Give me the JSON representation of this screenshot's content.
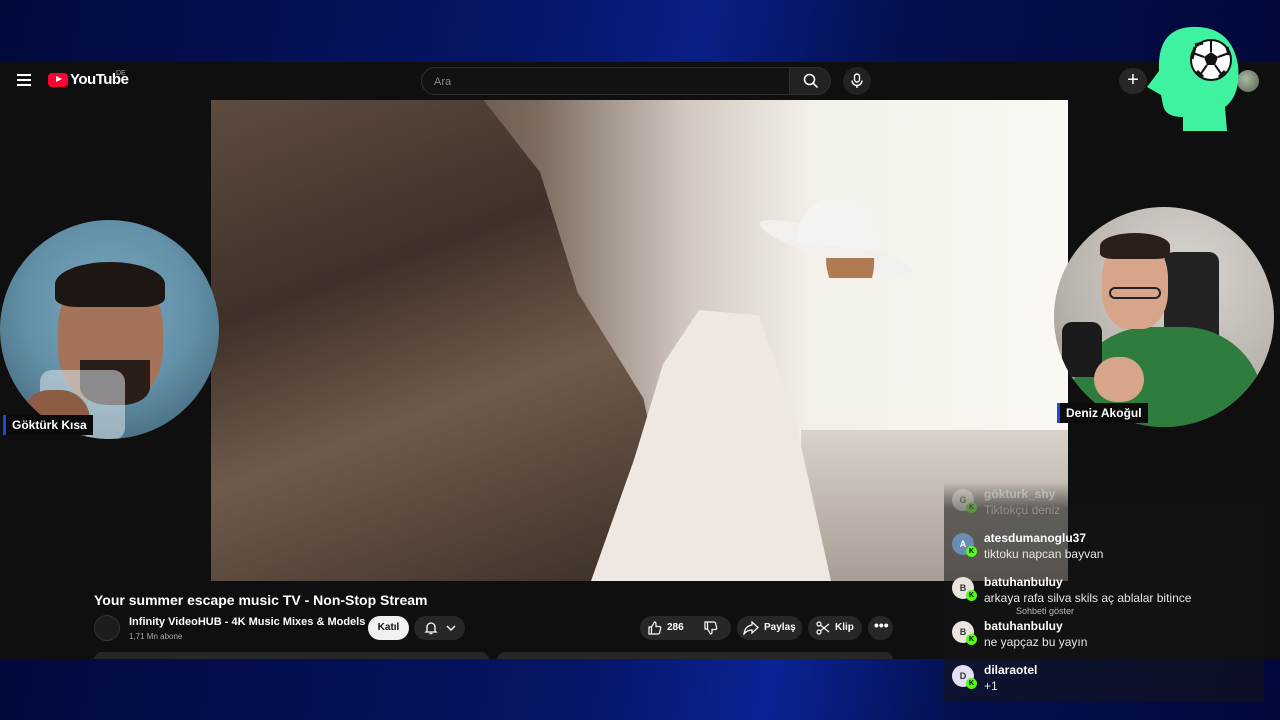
{
  "youtube": {
    "logo_text": "YouTube",
    "country_code": "DE",
    "search_placeholder": "Ara"
  },
  "video": {
    "title": "Your summer escape music TV - Non-Stop Stream",
    "channel_name": "Infinity VideoHUB - 4K Music Mixes & Models",
    "subscribers": "1,71 Mn abone",
    "join_label": "Katıl",
    "like_count": "286",
    "share_label": "Paylaş",
    "clip_label": "Klip"
  },
  "streamers": {
    "left_name": "Göktürk Kısa",
    "right_name": "Deniz Akoğul"
  },
  "chat": {
    "show_chat_label": "Sohbeti göster",
    "messages": [
      {
        "initial": "G",
        "user": "gökturk_shy",
        "text": "Tiktokçu deniz"
      },
      {
        "initial": "A",
        "user": "atesdumanoglu37",
        "text": "tiktoku napcan bayvan"
      },
      {
        "initial": "B",
        "user": "batuhanbuluy",
        "text": "arkaya rafa silva skils aç ablalar bitince"
      },
      {
        "initial": "B",
        "user": "batuhanbuluy",
        "text": "ne yapçaz bu yayın"
      },
      {
        "initial": "D",
        "user": "dilaraotel",
        "text": "+1"
      }
    ],
    "platform_badge": "K"
  },
  "colors": {
    "brand_green": "#3ff2a0",
    "youtube_red": "#ff0033",
    "kick_green": "#53fc18",
    "overlay_navy": "#061566"
  }
}
